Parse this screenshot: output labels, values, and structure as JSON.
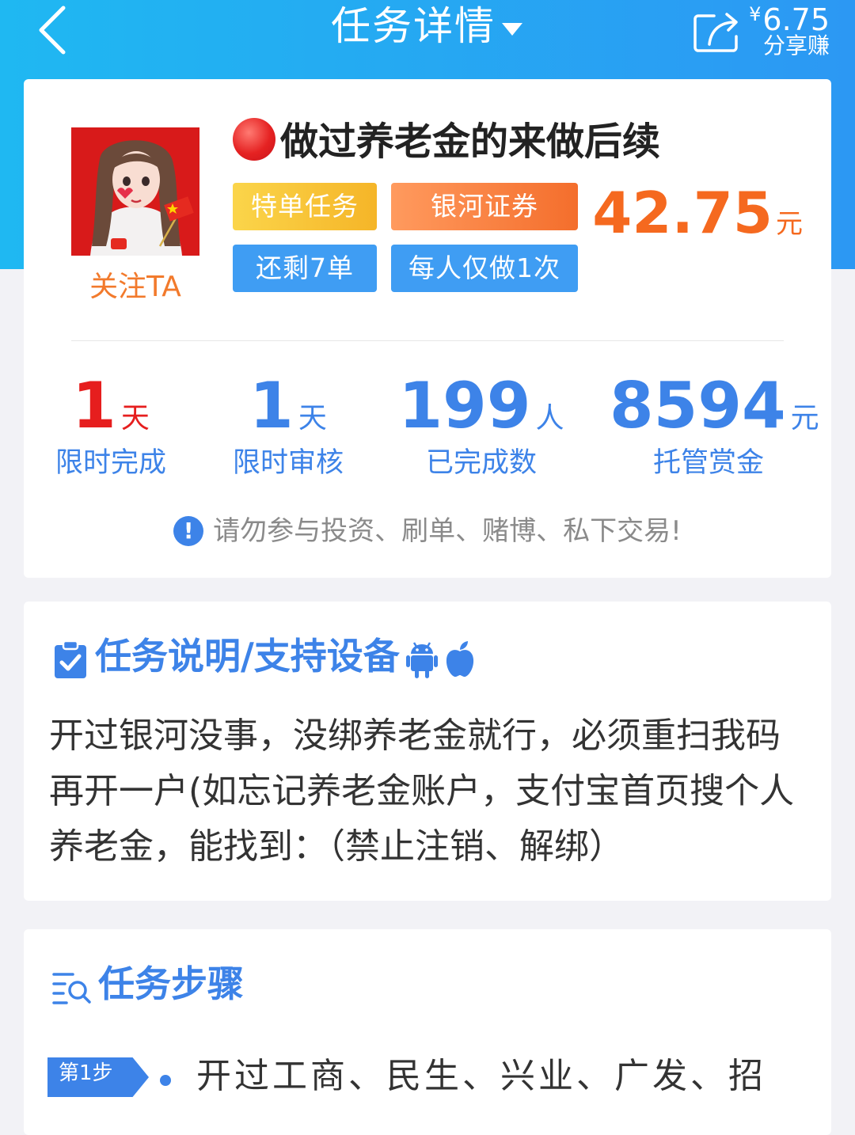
{
  "header": {
    "title": "任务详情",
    "share_currency": "¥",
    "share_amount": "6.75",
    "share_label": "分享赚"
  },
  "task": {
    "follow_label": "关注TA",
    "title": "做过养老金的来做后续",
    "tags": [
      "特单任务",
      "银河证券",
      "还剩7单",
      "每人仅做1次"
    ],
    "price": "42.75",
    "price_unit": "元"
  },
  "stats": [
    {
      "value": "1",
      "unit": "天",
      "label": "限时完成"
    },
    {
      "value": "1",
      "unit": "天",
      "label": "限时审核"
    },
    {
      "value": "199",
      "unit": "人",
      "label": "已完成数"
    },
    {
      "value": "8594",
      "unit": "元",
      "label": "托管赏金"
    }
  ],
  "warning": "请勿参与投资、刷单、赌博、私下交易!",
  "description": {
    "title": "任务说明/支持设备",
    "text": "开过银河没事，没绑养老金就行，必须重扫我码再开一户(如忘记养老金账户，支付宝首页搜个人养老金，能找到：（禁止注销、解绑）"
  },
  "steps": {
    "title": "任务步骤",
    "first_badge": "第1步",
    "first_text": "开过工商、民生、兴业、广发、招"
  },
  "colors": {
    "brand_blue": "#3d83e8",
    "header_gradient_start": "#1fb8f2",
    "header_gradient_end": "#2c98f3",
    "price_orange": "#f5691f",
    "stat_red": "#e61e1e"
  },
  "icons": {
    "back": "chevron-left-icon",
    "dropdown": "caret-down-icon",
    "share": "share-icon",
    "description": "clipboard-check-icon",
    "android": "android-icon",
    "apple": "apple-icon",
    "steps": "list-search-icon",
    "warning": "exclamation-icon"
  }
}
